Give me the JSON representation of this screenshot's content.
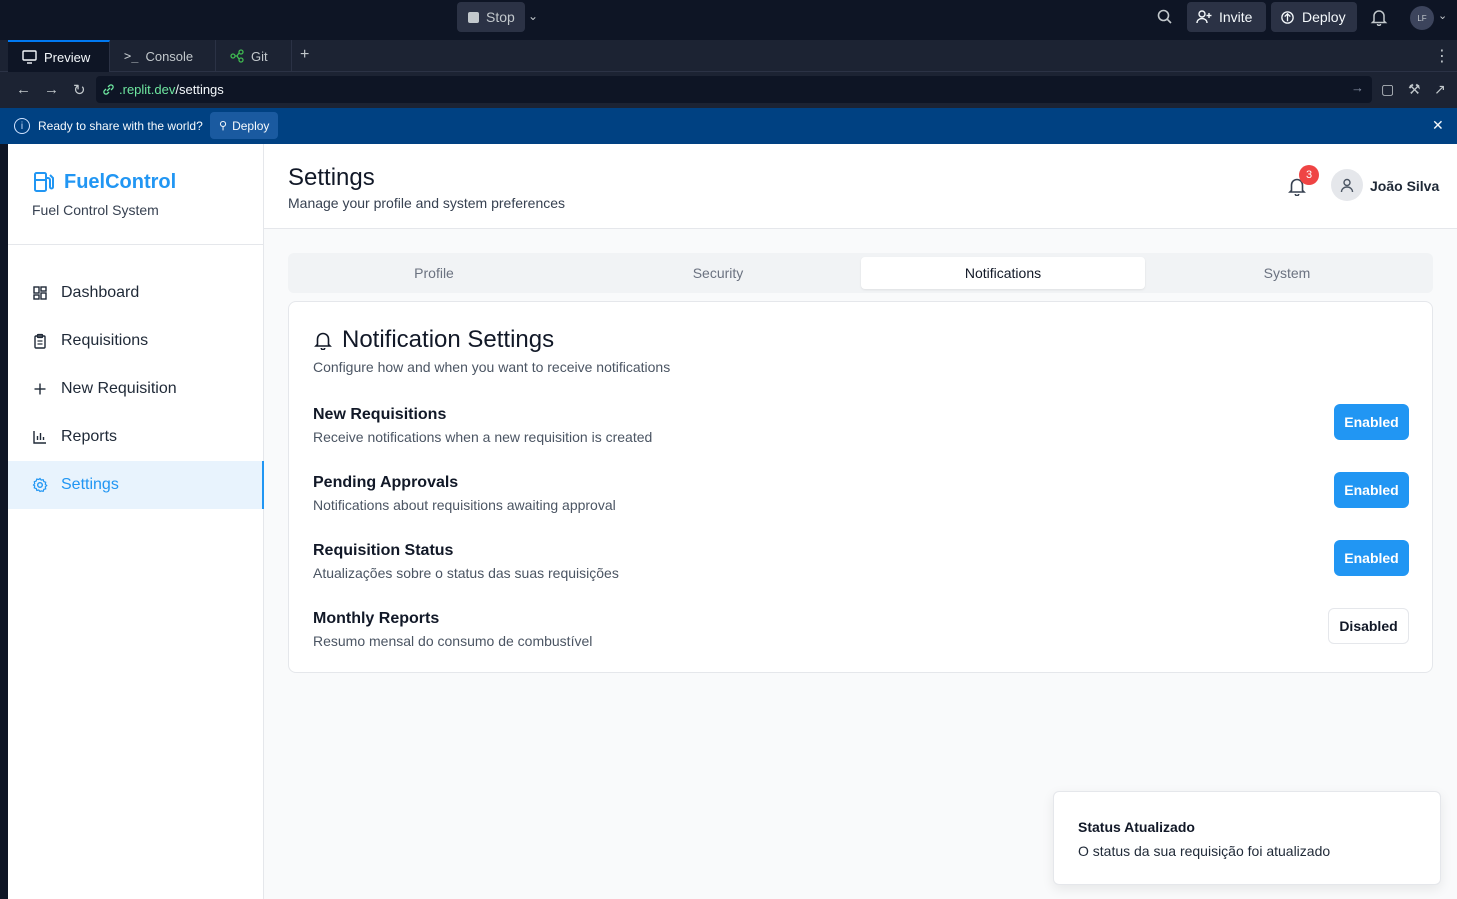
{
  "topbar": {
    "stop_label": "Stop",
    "invite_label": "Invite",
    "deploy_label": "Deploy",
    "avatar_initials": "LF"
  },
  "tabs": [
    {
      "label": "Preview",
      "icon": "monitor-icon"
    },
    {
      "label": "Console",
      "icon": "terminal-icon"
    },
    {
      "label": "Git",
      "icon": "git-icon"
    }
  ],
  "url": {
    "host": ".replit.dev",
    "path": "/settings"
  },
  "banner": {
    "text": "Ready to share with the world?",
    "deploy_label": "Deploy"
  },
  "sidebar": {
    "brand": "FuelControl",
    "subtitle": "Fuel Control System",
    "items": [
      {
        "label": "Dashboard",
        "icon": "grid-icon",
        "active": false
      },
      {
        "label": "Requisitions",
        "icon": "clipboard-icon",
        "active": false
      },
      {
        "label": "New Requisition",
        "icon": "plus-icon",
        "active": false
      },
      {
        "label": "Reports",
        "icon": "bar-chart-icon",
        "active": false
      },
      {
        "label": "Settings",
        "icon": "gear-icon",
        "active": true
      }
    ]
  },
  "header": {
    "title": "Settings",
    "subtitle": "Manage your profile and system preferences",
    "notification_count": "3",
    "user_name": "João Silva"
  },
  "settings_tabs": [
    {
      "label": "Profile",
      "active": false
    },
    {
      "label": "Security",
      "active": false
    },
    {
      "label": "Notifications",
      "active": true
    },
    {
      "label": "System",
      "active": false
    }
  ],
  "notification_card": {
    "title": "Notification Settings",
    "subtitle": "Configure how and when you want to receive notifications",
    "settings": [
      {
        "title": "New Requisitions",
        "description": "Receive notifications when a new requisition is created",
        "state": "Enabled"
      },
      {
        "title": "Pending Approvals",
        "description": "Notifications about requisitions awaiting approval",
        "state": "Enabled"
      },
      {
        "title": "Requisition Status",
        "description": "Atualizações sobre o status das suas requisições",
        "state": "Enabled"
      },
      {
        "title": "Monthly Reports",
        "description": "Resumo mensal do consumo de combustível",
        "state": "Disabled"
      }
    ]
  },
  "toast": {
    "title": "Status Atualizado",
    "message": "O status da sua requisição foi atualizado"
  },
  "colors": {
    "accent": "#2196f3",
    "banner": "#004182",
    "badge": "#ef4444"
  }
}
